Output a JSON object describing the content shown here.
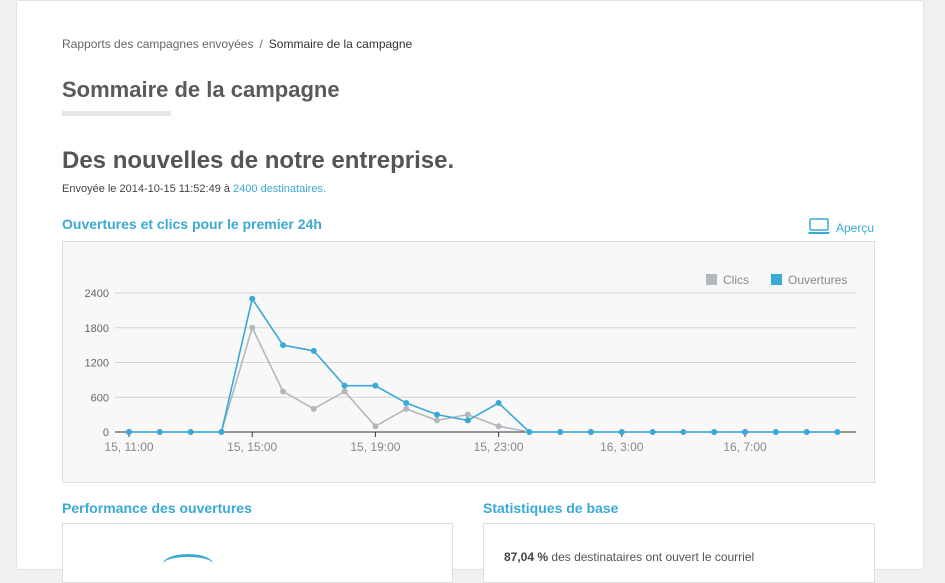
{
  "breadcrumb": {
    "parent": "Rapports des campagnes envoyées",
    "separator": "/",
    "current": "Sommaire de la campagne"
  },
  "page_title": "Sommaire de la campagne",
  "campaign": {
    "name": "Des nouvelles de notre entreprise.",
    "sent_prefix": "Envoyée le 2014-10-15 11:52:49 à",
    "recipients_link": "2400 destinataires."
  },
  "sections": {
    "chart_title": "Ouvertures et clics pour le premier 24h",
    "preview_label": "Aperçu",
    "performance_title": "Performance des ouvertures",
    "stats_title": "Statistiques de base",
    "stats_snippet_value": "87,04 %",
    "stats_snippet_text": "des destinataires ont ouvert le courriel"
  },
  "colors": {
    "accent": "#3aa9d6",
    "clicks": "#b3b8bf",
    "opens": "#3aa9d6"
  },
  "icons": {
    "preview": "laptop-icon"
  },
  "chart_data": {
    "type": "line",
    "title": "",
    "xlabel": "",
    "ylabel": "",
    "ylim": [
      0,
      2400
    ],
    "yticks": [
      0,
      600,
      1200,
      1800,
      2400
    ],
    "x": [
      "15, 11:00",
      "15, 12:00",
      "15, 13:00",
      "15, 14:00",
      "15, 15:00",
      "15, 16:00",
      "15, 17:00",
      "15, 18:00",
      "15, 19:00",
      "15, 20:00",
      "15, 21:00",
      "15, 22:00",
      "15, 23:00",
      "16, 0:00",
      "16, 1:00",
      "16, 2:00",
      "16, 3:00",
      "16, 4:00",
      "16, 5:00",
      "16, 6:00",
      "16, 7:00",
      "16, 8:00",
      "16, 9:00",
      "16, 10:00"
    ],
    "xtick_labels": [
      {
        "index": 0,
        "label": "15, 11:00"
      },
      {
        "index": 4,
        "label": "15, 15:00"
      },
      {
        "index": 8,
        "label": "15, 19:00"
      },
      {
        "index": 12,
        "label": "15, 23:00"
      },
      {
        "index": 16,
        "label": "16, 3:00"
      },
      {
        "index": 20,
        "label": "16, 7:00"
      }
    ],
    "grid": true,
    "legend_position": "top-right",
    "series": [
      {
        "name": "Clics",
        "color": "#b3b8bf",
        "values": [
          0,
          0,
          0,
          0,
          1800,
          700,
          400,
          700,
          100,
          400,
          200,
          300,
          100,
          0,
          0,
          0,
          0,
          0,
          0,
          0,
          0,
          0,
          0,
          0
        ]
      },
      {
        "name": "Ouvertures",
        "color": "#3aa9d6",
        "values": [
          0,
          0,
          0,
          0,
          2300,
          1500,
          1400,
          800,
          800,
          500,
          300,
          200,
          500,
          0,
          0,
          0,
          0,
          0,
          0,
          0,
          0,
          0,
          0,
          0
        ]
      }
    ]
  }
}
